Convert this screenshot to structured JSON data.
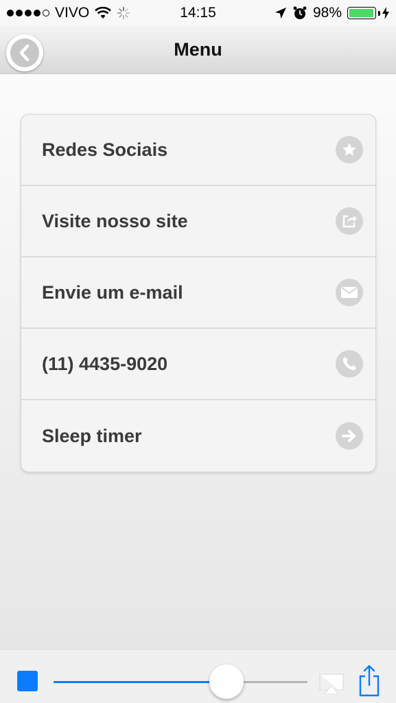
{
  "status_bar": {
    "carrier": "VIVO",
    "time": "14:15",
    "battery_percent": "98%",
    "battery_level": 0.98,
    "signal_bars_filled": 4,
    "signal_bars_total": 5
  },
  "nav": {
    "title": "Menu",
    "back_icon": "chevron-left-icon"
  },
  "menu": {
    "items": [
      {
        "label": "Redes Sociais",
        "icon": "star-icon"
      },
      {
        "label": "Visite nosso site",
        "icon": "share-out-icon"
      },
      {
        "label": "Envie um e-mail",
        "icon": "envelope-icon"
      },
      {
        "label": "(11) 4435-9020",
        "icon": "phone-icon"
      },
      {
        "label": "Sleep timer",
        "icon": "arrow-right-icon"
      }
    ]
  },
  "player": {
    "volume_level": 0.68,
    "stop_icon": "stop-icon",
    "airplay_icon": "airplay-icon",
    "share_icon": "share-icon"
  },
  "colors": {
    "accent": "#0a7cff",
    "battery_green": "#4cd964",
    "icon_gray": "#d4d4d4"
  }
}
